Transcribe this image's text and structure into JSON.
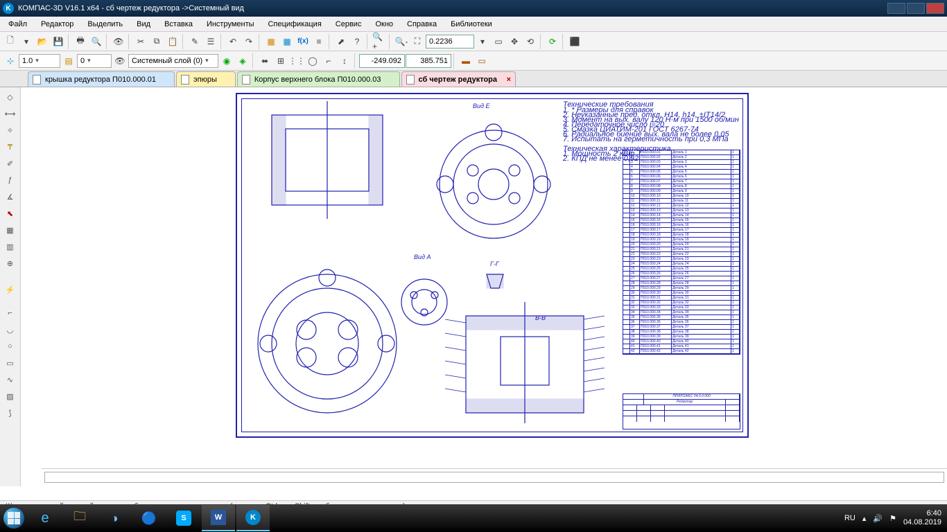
{
  "title": "КОМПАС-3D V16.1 x64 - сб чертеж редуктора ->Системный вид",
  "menu": [
    "Файл",
    "Редактор",
    "Выделить",
    "Вид",
    "Вставка",
    "Инструменты",
    "Спецификация",
    "Сервис",
    "Окно",
    "Справка",
    "Библиотеки"
  ],
  "tb2": {
    "scale": "1.0",
    "layer_num": "0",
    "layer_name": "Системный слой (0)"
  },
  "coords": {
    "zoom": "0.2236",
    "x": "-249.092",
    "y": "385.751"
  },
  "tabs": [
    {
      "label": "крышка редуктора П010.000.01",
      "color": "blue"
    },
    {
      "label": "эпюры",
      "color": "yellow"
    },
    {
      "label": "Корпус верхнего блока П010.000.03",
      "color": "green"
    },
    {
      "label": "сб чертеж редуктора",
      "color": "pink",
      "active": true
    }
  ],
  "views": {
    "e": "Вид Е",
    "a": "Вид А",
    "gg": "Г-Г",
    "bb": "В-В"
  },
  "titleblock": {
    "project": "ПРИЛОЖЕС 04.0.0.000",
    "name": "Редуктор"
  },
  "status": "Щелкните левой кнопкой мыши на объекте для его выделения (вместе с Ctrl или Shift - добавить к выделенным)",
  "tray": {
    "lang": "RU",
    "time": "6:40",
    "date": "04.08.2019"
  },
  "bom_rows": 42
}
